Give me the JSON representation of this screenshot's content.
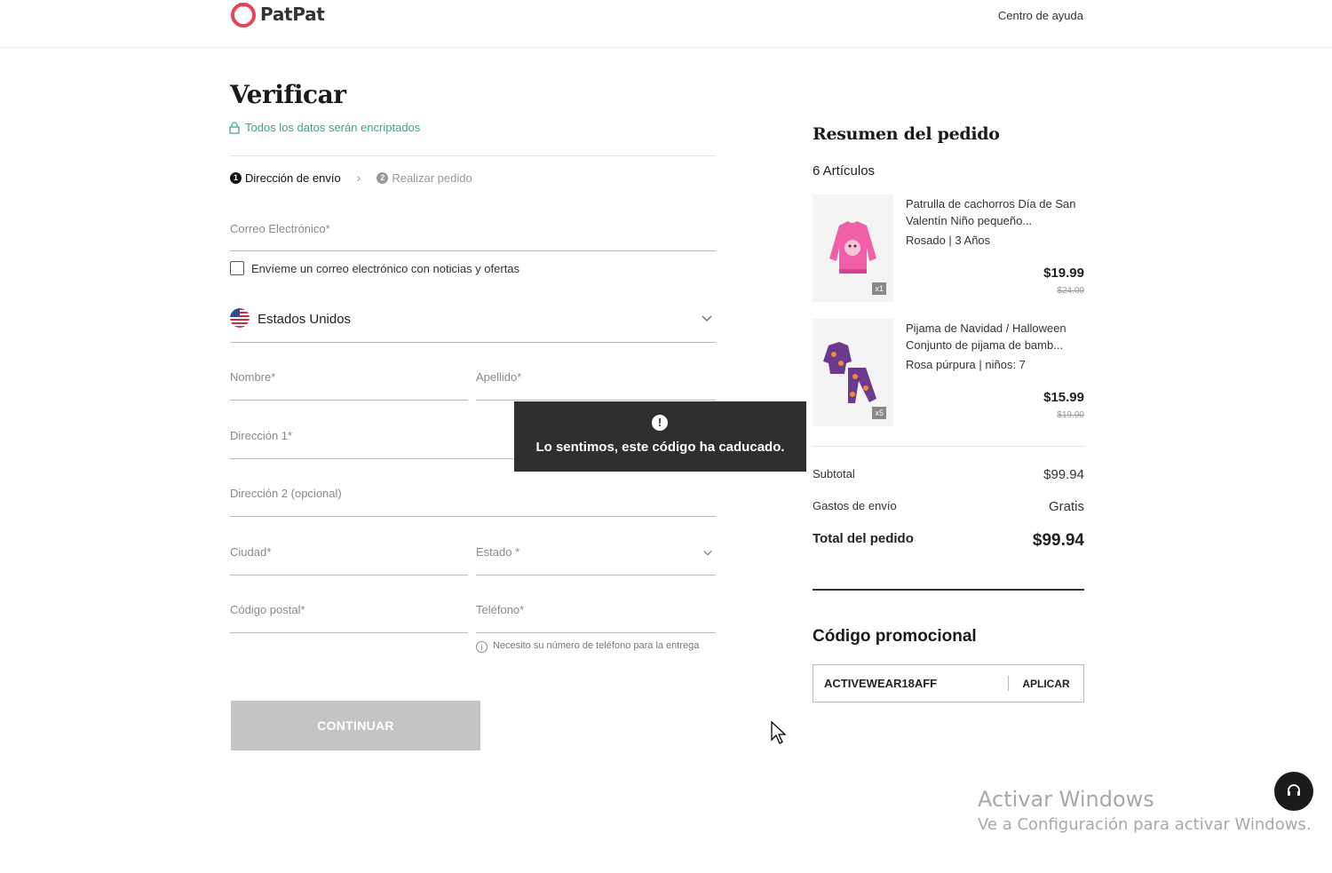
{
  "header": {
    "logo_text": "PatPat",
    "help_link": "Centro de ayuda"
  },
  "checkout": {
    "title": "Verificar",
    "secure_note": "Todos los datos serán encriptados",
    "steps": [
      {
        "num": "1",
        "label": "Dirección de envío"
      },
      {
        "num": "2",
        "label": "Realizar pedido"
      }
    ],
    "fields": {
      "email": "Correo Electrónico*",
      "newsletter": "Envíeme un correo electrónico con noticias y ofertas",
      "country": "Estados Unidos",
      "first_name": "Nombre*",
      "last_name": "Apellido*",
      "address1": "Dirección 1*",
      "address2": "Dirección 2 (opcional)",
      "city": "Ciudad*",
      "state": "Estado *",
      "postal": "Código postal*",
      "phone": "Teléfono*"
    },
    "phone_note": "Necesito su número de teléfono para la entrega",
    "continue_label": "CONTINUAR"
  },
  "toast": {
    "icon": "!",
    "message": "Lo sentimos, este código ha caducado."
  },
  "summary": {
    "title": "Resumen del pedido",
    "items_count": "6 Artículos",
    "items": [
      {
        "name": "Patrulla de cachorros Día de San Valentín Niño pequeño...",
        "variant": "Rosado | 3 Años",
        "qty": "x1",
        "price": "$19.99",
        "orig_price": "$24.00"
      },
      {
        "name": "Pijama de Navidad / Halloween Conjunto de pijama de bamb...",
        "variant": "Rosa púrpura | niños: 7",
        "qty": "x5",
        "price": "$15.99",
        "orig_price": "$19.00"
      }
    ],
    "subtotal_label": "Subtotal",
    "subtotal": "$99.94",
    "shipping_label": "Gastos de envío",
    "shipping": "Gratis",
    "total_label": "Total del pedido",
    "total": "$99.94"
  },
  "promo": {
    "title": "Código promocional",
    "code": "ACTIVEWEAR18AFF",
    "apply_label": "APLICAR"
  },
  "watermark": {
    "line1": "Activar Windows",
    "line2": "Ve a Configuración para activar Windows."
  },
  "colors": {
    "accent_green": "#3aa678",
    "logo_red": "#e8425a",
    "toast_bg": "#2f2f2f",
    "button_disabled": "#c4c4c4"
  }
}
